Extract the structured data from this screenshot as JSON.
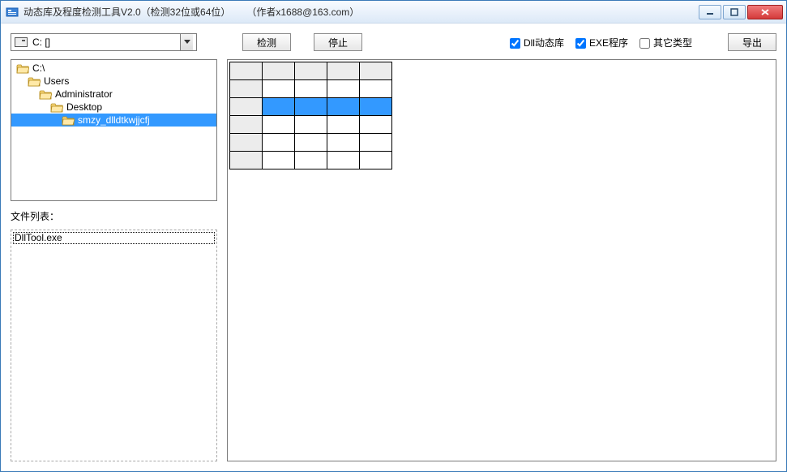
{
  "window": {
    "title": "动态库及程度检测工具V2.0（检测32位或64位）      （作者x1688@163.com）"
  },
  "drive": {
    "text": "C: []"
  },
  "toolbar": {
    "detect": "检测",
    "stop": "停止",
    "export": "导出"
  },
  "checks": {
    "dll": {
      "label": "Dll动态库",
      "checked": true
    },
    "exe": {
      "label": "EXE程序",
      "checked": true
    },
    "other": {
      "label": "其它类型",
      "checked": false
    }
  },
  "tree": {
    "nodes": [
      {
        "label": "C:\\",
        "depth": 0,
        "selected": false
      },
      {
        "label": "Users",
        "depth": 1,
        "selected": false
      },
      {
        "label": "Administrator",
        "depth": 2,
        "selected": false
      },
      {
        "label": "Desktop",
        "depth": 3,
        "selected": false
      },
      {
        "label": "smzy_dlldtkwjjcfj",
        "depth": 4,
        "selected": true
      }
    ]
  },
  "filelist": {
    "label": "文件列表：",
    "items": [
      {
        "name": "DllTool.exe",
        "selected": true
      }
    ]
  },
  "grid": {
    "cols": 4,
    "rows": 5,
    "selected_row": 1
  }
}
